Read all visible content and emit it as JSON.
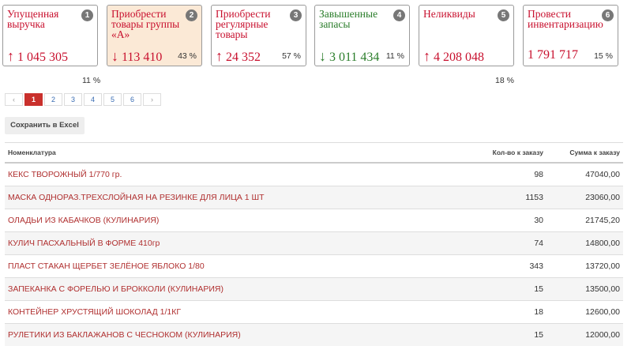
{
  "cards": [
    {
      "title": "Упущенная выручка",
      "badge": "1",
      "arrow": "↑",
      "value": "1 045 305",
      "color": "#c8102e",
      "pct": "",
      "below": "11 %"
    },
    {
      "title": "Приобрести товары группы «А»",
      "badge": "2",
      "arrow": "↓",
      "value": "113 410",
      "color": "#c8102e",
      "pct": "43 %",
      "below": ""
    },
    {
      "title": "Приобрести регулярные товары",
      "badge": "3",
      "arrow": "↑",
      "value": "24 352",
      "color": "#c8102e",
      "pct": "57 %",
      "below": ""
    },
    {
      "title": "Завышенные запасы",
      "badge": "4",
      "arrow": "↓",
      "value": "3 011 434",
      "color": "#2a7d2a",
      "pct": "11 %",
      "below": ""
    },
    {
      "title": "Неликвиды",
      "badge": "5",
      "arrow": "↑",
      "value": "4 208 048",
      "color": "#c8102e",
      "pct": "",
      "below": "18 %"
    },
    {
      "title": "Провести инвентаризацию",
      "badge": "6",
      "arrow": "",
      "value": "1 791 717",
      "color": "#c8102e",
      "pct": "15 %",
      "below": ""
    }
  ],
  "pager": {
    "prev": "‹",
    "next": "›",
    "pages": [
      "1",
      "2",
      "3",
      "4",
      "5",
      "6"
    ],
    "current": "1"
  },
  "excel_button": "Сохранить в Excel",
  "table": {
    "headers": {
      "name": "Номенклатура",
      "qty": "Кол-во к заказу",
      "sum": "Сумма к заказу"
    },
    "rows": [
      {
        "name": "КЕКС ТВОРОЖНЫЙ 1/770 гр.",
        "qty": "98",
        "sum": "47040,00"
      },
      {
        "name": "МАСКА ОДНОРАЗ.ТРЕХСЛОЙНАЯ НА РЕЗИНКЕ ДЛЯ ЛИЦА 1 ШТ",
        "qty": "1153",
        "sum": "23060,00"
      },
      {
        "name": "ОЛАДЬИ ИЗ КАБАЧКОВ (КУЛИНАРИЯ)",
        "qty": "30",
        "sum": "21745,20"
      },
      {
        "name": "КУЛИЧ ПАСХАЛЬНЫЙ В ФОРМЕ 410гр",
        "qty": "74",
        "sum": "14800,00"
      },
      {
        "name": "ПЛАСТ СТАКАН ЩЕРБЕТ ЗЕЛЁНОЕ ЯБЛОКО 1/80",
        "qty": "343",
        "sum": "13720,00"
      },
      {
        "name": "ЗАПЕКАНКА С ФОРЕЛЬЮ И БРОККОЛИ (КУЛИНАРИЯ)",
        "qty": "15",
        "sum": "13500,00"
      },
      {
        "name": "КОНТЕЙНЕР ХРУСТЯЩИЙ ШОКОЛАД 1/1КГ",
        "qty": "18",
        "sum": "12600,00"
      },
      {
        "name": "РУЛЕТИКИ ИЗ БАКЛАЖАНОВ С ЧЕСНОКОМ (КУЛИНАРИЯ)",
        "qty": "15",
        "sum": "12000,00"
      }
    ]
  }
}
